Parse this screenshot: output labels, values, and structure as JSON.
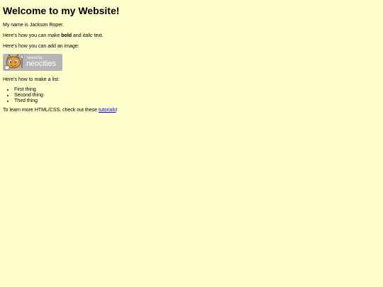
{
  "heading": "Welcome to my Website!",
  "intro": "My name is Jackson Roper.",
  "format": {
    "before": "Here's how you can make ",
    "bold": "bold",
    "middle": " and ",
    "italic": "italic",
    "after": " text."
  },
  "image_line": "Here's how you can add an image:",
  "badge": {
    "small_text": "hosted by",
    "brand_text": "neocities",
    "icon": "neocities-cat-icon",
    "colors": {
      "background": "#b5b5b5",
      "cat": "#f29b28"
    }
  },
  "list_intro": "Here's how to make a list:",
  "list_items": [
    "First thing",
    "Second thing",
    "Third thing"
  ],
  "learn": {
    "before": "To learn more HTML/CSS, check out these ",
    "link": "tutorials",
    "after": "!"
  },
  "colors": {
    "page_background": "#ffffcd",
    "link": "#0000ee"
  }
}
